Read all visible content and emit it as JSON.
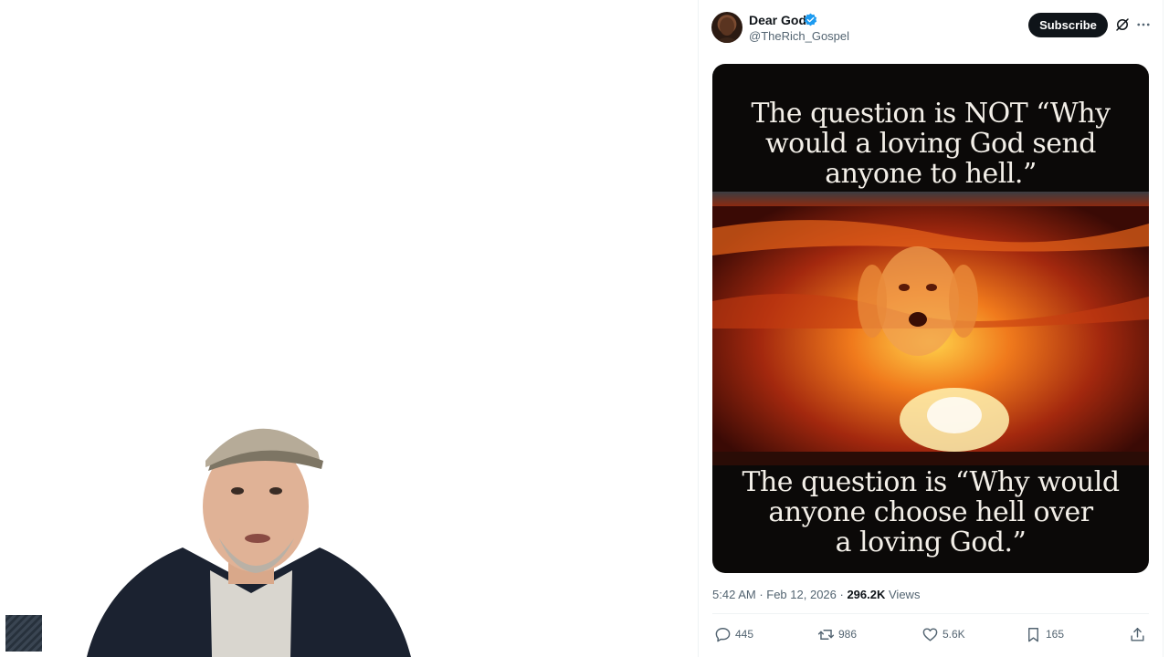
{
  "tweet": {
    "author": {
      "name": "Dear God",
      "handle": "@TheRich_Gospel",
      "verified": true
    },
    "subscribe_label": "Subscribe",
    "image": {
      "top_text": [
        "The question is NOT “Why",
        "would a loving God send",
        "anyone to hell.”"
      ],
      "bottom_text": [
        "The question is “Why would",
        "anyone choose hell over",
        "a loving God.”"
      ]
    },
    "time": "5:42 AM",
    "date": "Feb 12, 2026",
    "views_count": "296.2K",
    "views_label": "Views",
    "actions": {
      "replies": "445",
      "reposts": "986",
      "likes": "5.6K",
      "bookmarks": "165"
    }
  },
  "icons": {
    "verified": "verified-badge-icon",
    "grok": "grok-icon",
    "more": "more-icon",
    "reply": "reply-icon",
    "repost": "repost-icon",
    "like": "like-icon",
    "bookmark": "bookmark-icon",
    "share": "share-icon"
  },
  "colors": {
    "verified_blue": "#1d9bf0",
    "subscribe_bg": "#0f1419",
    "secondary_text": "#536471"
  }
}
